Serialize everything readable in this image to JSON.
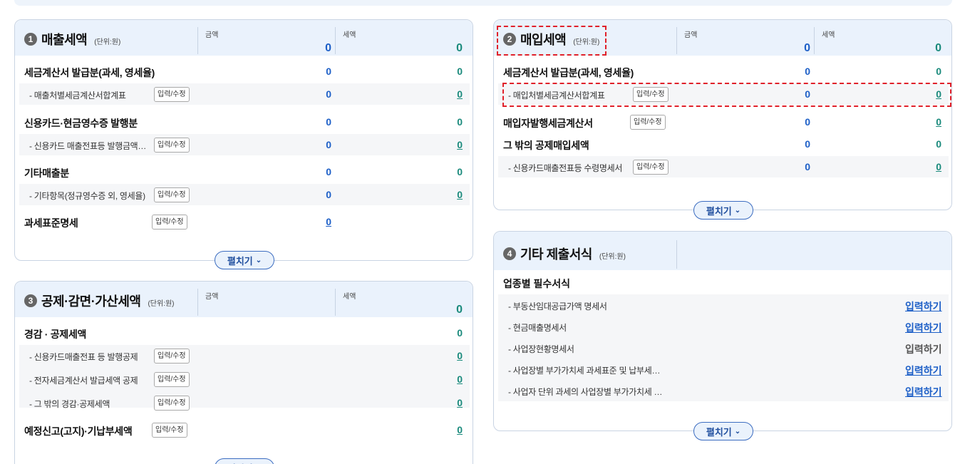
{
  "common": {
    "edit_label": "입력/수정",
    "expand_label": "펼치기",
    "input_label": "입력하기",
    "amount_label": "금액",
    "tax_label": "세액"
  },
  "colors": {
    "accent_blue": "#1d5fc7",
    "teal": "#1a8a7c",
    "highlight_red": "#e0202a"
  },
  "sales": {
    "number": "1",
    "title": "매출세액",
    "unit": "(단위:원)",
    "amount_total": "0",
    "tax_total": "0",
    "rows": [
      {
        "label": "세금계산서 발급분(과세, 영세율)",
        "amount": "0",
        "tax": "0"
      },
      {
        "label": "- 매출처별세금계산서합계표",
        "amount": "0",
        "tax": "0"
      },
      {
        "label": "신용카드·현금영수증 발행분",
        "amount": "0",
        "tax": "0"
      },
      {
        "label": "- 신용카드 매출전표등 발행금액…",
        "amount": "0",
        "tax": "0"
      },
      {
        "label": "기타매출분",
        "amount": "0",
        "tax": "0"
      },
      {
        "label": "- 기타항목(정규영수증 외, 영세율)",
        "amount": "0",
        "tax": "0"
      },
      {
        "label": "과세표준명세",
        "amount": "0"
      }
    ]
  },
  "purchase": {
    "number": "2",
    "title": "매입세액",
    "unit": "(단위:원)",
    "amount_total": "0",
    "tax_total": "0",
    "rows": [
      {
        "label": "세금계산서 발급분(과세, 영세율)",
        "amount": "0",
        "tax": "0"
      },
      {
        "label": "- 매입처별세금계산서합계표",
        "amount": "0",
        "tax": "0"
      },
      {
        "label": "매입자발행세금계산서",
        "amount": "0",
        "tax": "0"
      },
      {
        "label": "그 밖의 공제매입세액",
        "amount": "0",
        "tax": "0"
      },
      {
        "label": "- 신용카드매출전표등 수령명세서",
        "amount": "0",
        "tax": "0"
      }
    ]
  },
  "deduction": {
    "number": "3",
    "title": "공제·감면·가산세액",
    "unit": "(단위:원)",
    "tax_total": "0",
    "rows": [
      {
        "label": "경감 · 공제세액",
        "tax": "0"
      },
      {
        "label": "- 신용카드매출전표 등 발행공제",
        "tax": "0"
      },
      {
        "label": "- 전자세금계산서 발급세액 공제",
        "tax": "0"
      },
      {
        "label": "- 그 밖의 경감·공제세액",
        "tax": "0"
      },
      {
        "label": "예정신고(고지)·기납부세액",
        "tax": "0"
      }
    ]
  },
  "other": {
    "number": "4",
    "title": "기타 제출서식",
    "unit": "(단위:원)",
    "group_title": "업종별 필수서식",
    "rows": [
      {
        "label": "- 부동산임대공급가액 명세서"
      },
      {
        "label": "- 현금매출명세서"
      },
      {
        "label": "- 사업장현황명세서"
      },
      {
        "label": "- 사업장별 부가가치세 과세표준 및 납부세…"
      },
      {
        "label": "- 사업자 단위 과세의 사업장별 부가가치세 …"
      }
    ]
  }
}
